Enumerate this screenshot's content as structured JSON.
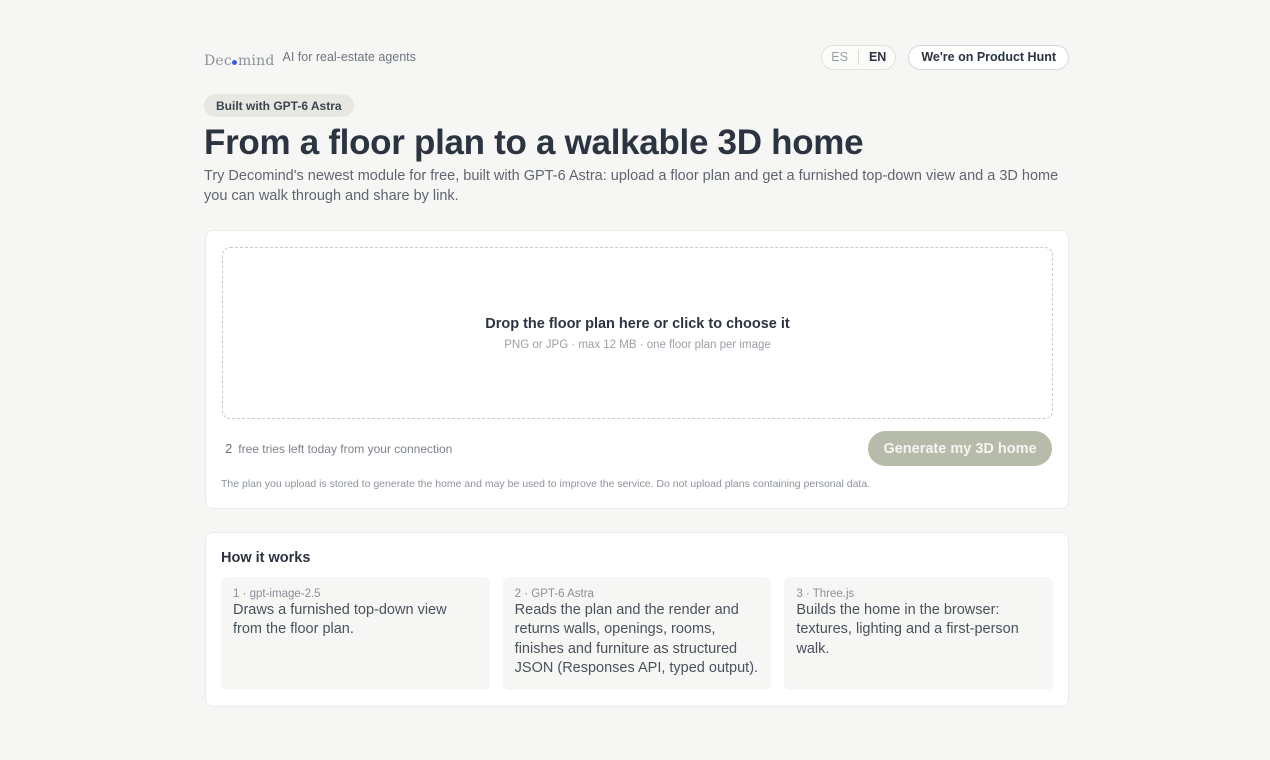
{
  "header": {
    "logo_text_left": "Dec",
    "logo_text_right": "mind",
    "tagline": "AI for real-estate agents",
    "languages": [
      {
        "code": "ES",
        "active": false
      },
      {
        "code": "EN",
        "active": true
      }
    ],
    "product_hunt_label": "We're on Product Hunt"
  },
  "hero": {
    "badge": "Built with GPT-6 Astra",
    "title": "From a floor plan to a walkable 3D home",
    "subtitle": "Try Decomind's newest module for free, built with GPT-6 Astra: upload a floor plan and get a furnished top-down view and a 3D home you can walk through and share by link."
  },
  "upload": {
    "drop_title": "Drop the floor plan here or click to choose it",
    "drop_hint": "PNG or JPG · max 12 MB · one floor plan per image",
    "tries_count": "2",
    "tries_text": "free tries left today from your connection",
    "generate_label": "Generate my 3D home",
    "disclaimer": "The plan you upload is stored to generate the home and may be used to improve the service. Do not upload plans containing personal data."
  },
  "how": {
    "title": "How it works",
    "steps": [
      {
        "label": "1 · gpt-image-2.5",
        "text": "Draws a furnished top-down view from the floor plan."
      },
      {
        "label": "2 · GPT-6 Astra",
        "text": "Reads the plan and the render and returns walls, openings, rooms, finishes and furniture as structured JSON (Responses API, typed output)."
      },
      {
        "label": "3 · Three.js",
        "text": "Builds the home in the browser: textures, lighting and a first-person walk."
      }
    ]
  },
  "colors": {
    "background": "#f6f6f4",
    "text": "#2b3440",
    "badge_bg": "#e6e8e1",
    "generate_disabled": "#b7bcaa",
    "logo_accent": "#3b5bdb"
  }
}
